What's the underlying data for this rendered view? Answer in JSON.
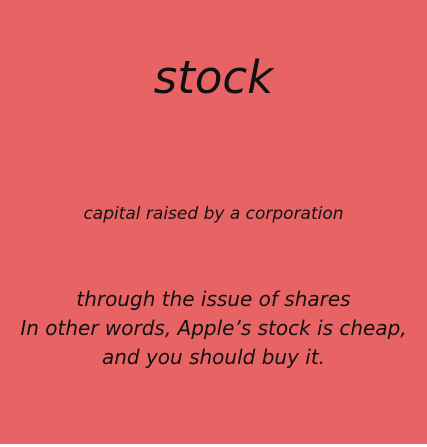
{
  "card": {
    "background": "#e86464",
    "text_color": "#111111",
    "term": "stock",
    "definition": "capital raised by a corporation",
    "example_lines": [
      "through the issue of shares",
      "In other words, Apple’s stock is cheap,",
      "and you should buy it."
    ]
  }
}
